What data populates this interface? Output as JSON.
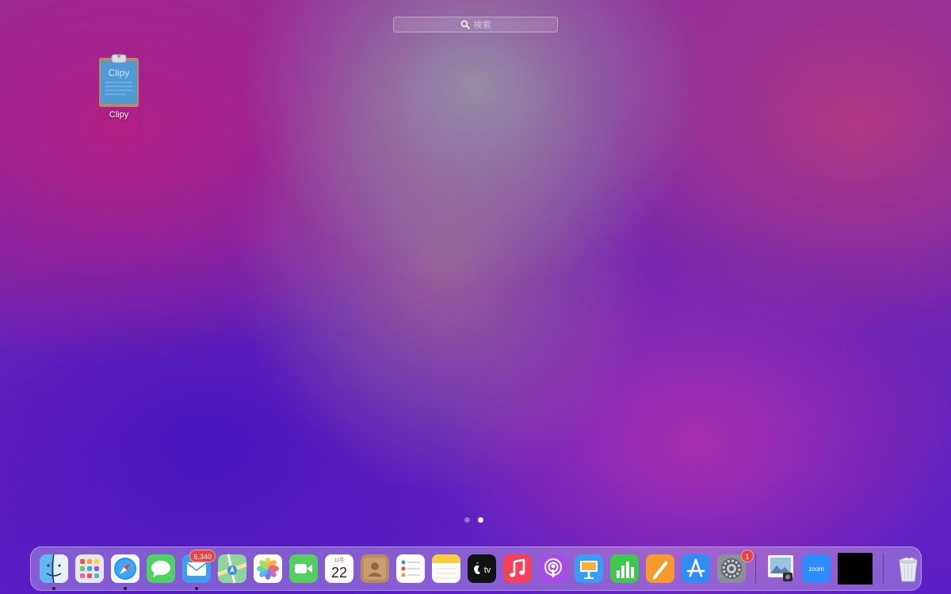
{
  "search": {
    "placeholder": "検索"
  },
  "desktop_apps": [
    {
      "name": "Clipy",
      "icon": "clipboard-icon"
    }
  ],
  "pager": {
    "current_page": 2,
    "total_pages": 2
  },
  "dock": {
    "apps": [
      {
        "name": "Finder",
        "icon": "finder-icon",
        "running": true
      },
      {
        "name": "Launchpad",
        "icon": "launchpad-icon",
        "running": false
      },
      {
        "name": "Safari",
        "icon": "safari-icon",
        "running": true
      },
      {
        "name": "Messages",
        "icon": "messages-icon",
        "running": false
      },
      {
        "name": "Mail",
        "icon": "mail-icon",
        "running": true,
        "badge": "6,340"
      },
      {
        "name": "Maps",
        "icon": "maps-icon",
        "running": false
      },
      {
        "name": "Photos",
        "icon": "photos-icon",
        "running": false
      },
      {
        "name": "FaceTime",
        "icon": "facetime-icon",
        "running": false
      },
      {
        "name": "Calendar",
        "icon": "calendar-icon",
        "running": false,
        "month": "11月",
        "day": "22"
      },
      {
        "name": "Contacts",
        "icon": "contacts-icon",
        "running": false
      },
      {
        "name": "Reminders",
        "icon": "reminders-icon",
        "running": false
      },
      {
        "name": "Notes",
        "icon": "notes-icon",
        "running": false
      },
      {
        "name": "TV",
        "icon": "tv-icon",
        "running": false,
        "label": "tv"
      },
      {
        "name": "Music",
        "icon": "music-icon",
        "running": false
      },
      {
        "name": "Podcasts",
        "icon": "podcasts-icon",
        "running": false
      },
      {
        "name": "Keynote",
        "icon": "keynote-icon",
        "running": false
      },
      {
        "name": "Numbers",
        "icon": "numbers-icon",
        "running": false
      },
      {
        "name": "Pages",
        "icon": "pages-icon",
        "running": false
      },
      {
        "name": "App Store",
        "icon": "app-store-icon",
        "running": false
      },
      {
        "name": "System Preferences",
        "icon": "gear-icon",
        "running": false,
        "badge": "1"
      }
    ],
    "recent": [
      {
        "name": "Preview",
        "icon": "preview-icon"
      },
      {
        "name": "Zoom",
        "icon": "zoom-icon",
        "label": "zoom"
      },
      {
        "name": "Black window",
        "icon": "black-thumbnail-icon"
      }
    ],
    "trash": {
      "name": "Trash",
      "icon": "trash-icon"
    }
  },
  "colors": {
    "badge": "#e5433d",
    "wallpaper_primary": "#8e2b9c",
    "wallpaper_secondary": "#5a1fc6"
  }
}
